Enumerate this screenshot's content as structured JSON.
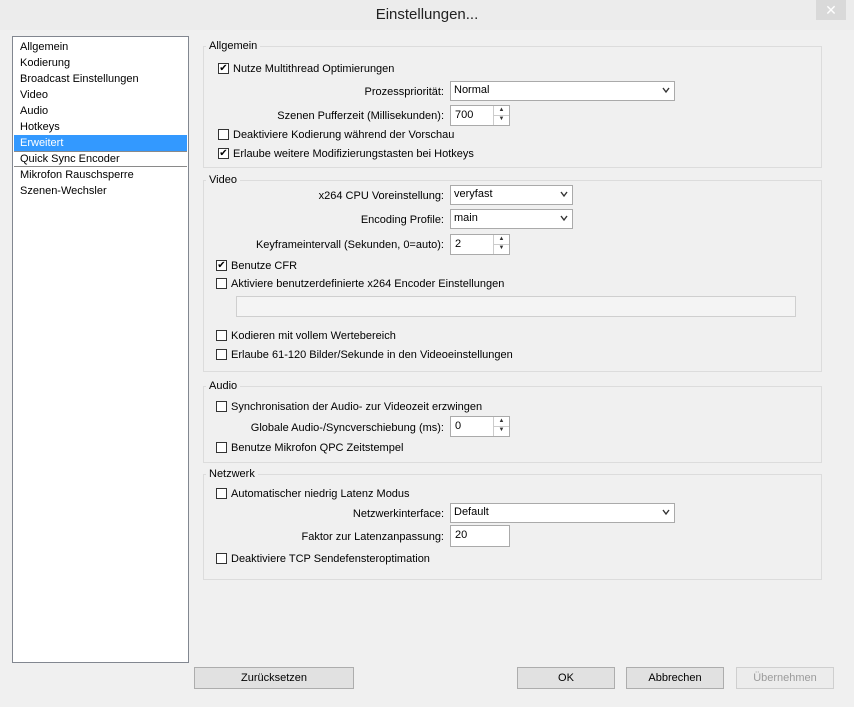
{
  "window": {
    "title": "Einstellungen...",
    "close_glyph": "✕"
  },
  "sidebar": {
    "items": [
      {
        "label": "Allgemein",
        "selected": false
      },
      {
        "label": "Kodierung",
        "selected": false
      },
      {
        "label": "Broadcast Einstellungen",
        "selected": false
      },
      {
        "label": "Video",
        "selected": false
      },
      {
        "label": "Audio",
        "selected": false
      },
      {
        "label": "Hotkeys",
        "selected": false
      },
      {
        "label": "Erweitert",
        "selected": true
      },
      {
        "label": "Quick Sync Encoder",
        "selected": false
      },
      {
        "label": "Mikrofon Rauschsperre",
        "selected": false
      },
      {
        "label": "Szenen-Wechsler",
        "selected": false
      }
    ]
  },
  "allgemein": {
    "label": "Allgemein",
    "multithread": {
      "label": "Nutze Multithread Optimierungen",
      "checked": true
    },
    "prio_label": "Prozesspriorität:",
    "prio_value": "Normal",
    "buffer_label": "Szenen Pufferzeit (Millisekunden):",
    "buffer_value": "700",
    "disable_encoding": {
      "label": "Deaktiviere Kodierung während der Vorschau",
      "checked": false
    },
    "allow_modifiers": {
      "label": "Erlaube weitere Modifizierungstasten bei Hotkeys",
      "checked": true
    }
  },
  "video": {
    "label": "Video",
    "preset_label": "x264 CPU Voreinstellung:",
    "preset_value": "veryfast",
    "profile_label": "Encoding Profile:",
    "profile_value": "main",
    "keyframe_label": "Keyframeintervall (Sekunden, 0=auto):",
    "keyframe_value": "2",
    "cfr": {
      "label": "Benutze CFR",
      "checked": true
    },
    "custom_x264": {
      "label": "Aktiviere benutzerdefinierte x264 Encoder Einstellungen",
      "checked": false
    },
    "custom_x264_value": "",
    "full_range": {
      "label": "Kodieren mit vollem Wertebereich",
      "checked": false
    },
    "allow_fps": {
      "label": "Erlaube 61-120 Bilder/Sekunde in den Videoeinstellungen",
      "checked": false
    }
  },
  "audio": {
    "label": "Audio",
    "sync": {
      "label": "Synchronisation der Audio- zur Videozeit erzwingen",
      "checked": false
    },
    "offset_label": "Globale Audio-/Syncverschiebung (ms):",
    "offset_value": "0",
    "qpc": {
      "label": "Benutze Mikrofon QPC Zeitstempel",
      "checked": false
    }
  },
  "netzwerk": {
    "label": "Netzwerk",
    "low_latency": {
      "label": "Automatischer niedrig Latenz Modus",
      "checked": false
    },
    "iface_label": "Netzwerkinterface:",
    "iface_value": "Default",
    "factor_label": "Faktor zur Latenzanpassung:",
    "factor_value": "20",
    "tcp": {
      "label": "Deaktiviere TCP Sendefensteroptimation",
      "checked": false
    }
  },
  "buttons": {
    "reset": "Zurücksetzen",
    "ok": "OK",
    "cancel": "Abbrechen",
    "apply": "Übernehmen"
  },
  "glyphs": {
    "check": "✔",
    "spin_up": "▲",
    "spin_down": "▼"
  }
}
